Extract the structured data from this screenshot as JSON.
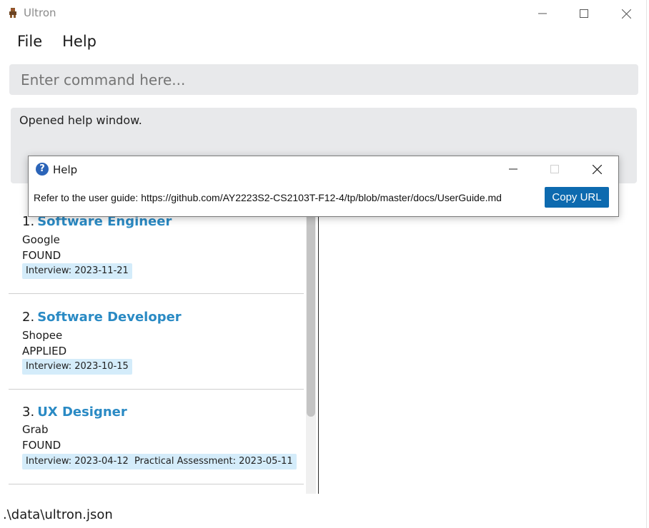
{
  "window": {
    "title": "Ultron",
    "icon": "ultron-robot-icon",
    "controls": [
      "minimize",
      "maximize",
      "close"
    ]
  },
  "menu": {
    "file": "File",
    "help": "Help"
  },
  "command": {
    "placeholder": "Enter command here...",
    "value": ""
  },
  "result": {
    "message": "Opened help window."
  },
  "openings": [
    {
      "index": "1.",
      "role": "Software Engineer",
      "company": "Google",
      "status": "FOUND",
      "dates": [
        "Interview: 2023-11-21"
      ]
    },
    {
      "index": "2.",
      "role": "Software Developer",
      "company": "Shopee",
      "status": "APPLIED",
      "dates": [
        "Interview: 2023-10-15"
      ]
    },
    {
      "index": "3.",
      "role": "UX Designer",
      "company": "Grab",
      "status": "FOUND",
      "dates": [
        "Interview: 2023-04-12",
        "Practical Assessment: 2023-05-11"
      ]
    }
  ],
  "status_bar": {
    "path": ".\\data\\ultron.json"
  },
  "help_window": {
    "title": "Help",
    "message": "Refer to the user guide: https://github.com/AY2223S2-CS2103T-F12-4/tp/blob/master/docs/UserGuide.md",
    "copy_button": "Copy URL"
  },
  "colors": {
    "role_title": "#2a8ac4",
    "tag_background": "#d4ecfa",
    "copy_button": "#0d6aaf",
    "input_background": "#e8e9eb"
  }
}
